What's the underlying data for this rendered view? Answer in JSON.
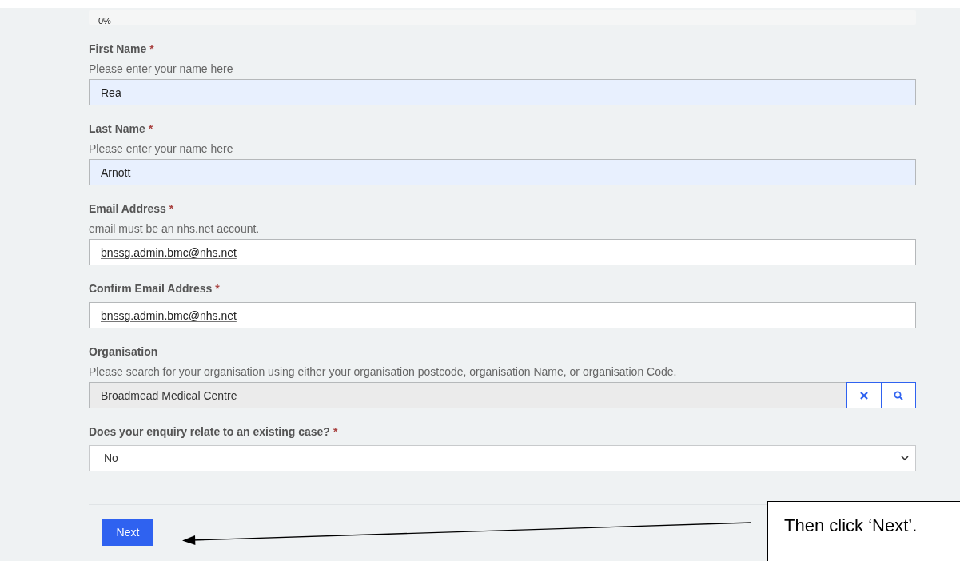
{
  "progress": {
    "label": "0%"
  },
  "fields": [
    {
      "kind": "text",
      "label": "First Name",
      "required_mark": "*",
      "hint": "Please enter your name here",
      "value": "Rea",
      "autofilled": true,
      "flagged": false
    },
    {
      "kind": "text",
      "label": "Last Name",
      "required_mark": "*",
      "hint": "Please enter your name here",
      "value": "Arnott",
      "autofilled": true,
      "flagged": false
    },
    {
      "kind": "text",
      "label": "Email Address",
      "required_mark": "*",
      "hint": "email must be an nhs.net account.",
      "value": "bnssg.admin.bmc@nhs.net",
      "autofilled": false,
      "flagged": true
    },
    {
      "kind": "text",
      "label": "Confirm Email Address",
      "required_mark": "*",
      "value": "bnssg.admin.bmc@nhs.net",
      "autofilled": false,
      "flagged": true
    },
    {
      "kind": "lookup",
      "label": "Organisation",
      "hint": "Please search for your organisation using either your organisation postcode, organisation Name, or organisation Code.",
      "value": "Broadmead Medical Centre"
    },
    {
      "kind": "select",
      "label": "Does your enquiry relate to an existing case?",
      "required_mark": "*",
      "value": "No"
    }
  ],
  "next_button": "Next",
  "callout": {
    "text": "Then click ‘Next’."
  }
}
